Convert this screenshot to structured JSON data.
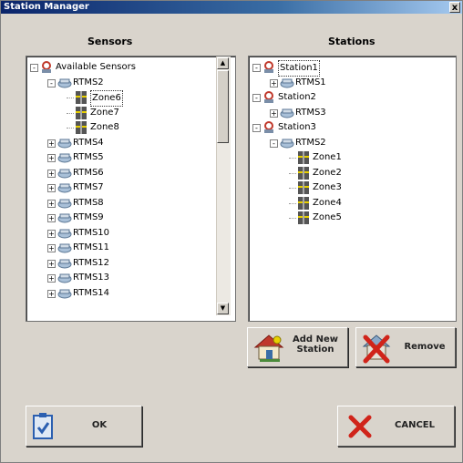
{
  "window": {
    "title": "Station Manager",
    "close_label": "x"
  },
  "sensors": {
    "heading": "Sensors",
    "tree": [
      {
        "label": "Available Sensors",
        "level": 0,
        "expander": "-",
        "icon": "station-icon"
      },
      {
        "label": "RTMS2",
        "level": 1,
        "expander": "-",
        "icon": "sensor-icon"
      },
      {
        "label": "Zone6",
        "level": 2,
        "expander": "",
        "icon": "zone-icon",
        "selected": true
      },
      {
        "label": "Zone7",
        "level": 2,
        "expander": "",
        "icon": "zone-icon"
      },
      {
        "label": "Zone8",
        "level": 2,
        "expander": "",
        "icon": "zone-icon"
      },
      {
        "label": "RTMS4",
        "level": 1,
        "expander": "+",
        "icon": "sensor-icon"
      },
      {
        "label": "RTMS5",
        "level": 1,
        "expander": "+",
        "icon": "sensor-icon"
      },
      {
        "label": "RTMS6",
        "level": 1,
        "expander": "+",
        "icon": "sensor-icon"
      },
      {
        "label": "RTMS7",
        "level": 1,
        "expander": "+",
        "icon": "sensor-icon"
      },
      {
        "label": "RTMS8",
        "level": 1,
        "expander": "+",
        "icon": "sensor-icon"
      },
      {
        "label": "RTMS9",
        "level": 1,
        "expander": "+",
        "icon": "sensor-icon"
      },
      {
        "label": "RTMS10",
        "level": 1,
        "expander": "+",
        "icon": "sensor-icon"
      },
      {
        "label": "RTMS11",
        "level": 1,
        "expander": "+",
        "icon": "sensor-icon"
      },
      {
        "label": "RTMS12",
        "level": 1,
        "expander": "+",
        "icon": "sensor-icon"
      },
      {
        "label": "RTMS13",
        "level": 1,
        "expander": "+",
        "icon": "sensor-icon"
      },
      {
        "label": "RTMS14",
        "level": 1,
        "expander": "+",
        "icon": "sensor-icon"
      }
    ]
  },
  "stations": {
    "heading": "Stations",
    "tree": [
      {
        "label": "Station1",
        "level": 0,
        "expander": "-",
        "icon": "station-icon",
        "selected": true
      },
      {
        "label": "RTMS1",
        "level": 1,
        "expander": "+",
        "icon": "sensor-icon"
      },
      {
        "label": "Station2",
        "level": 0,
        "expander": "-",
        "icon": "station-icon"
      },
      {
        "label": "RTMS3",
        "level": 1,
        "expander": "+",
        "icon": "sensor-icon"
      },
      {
        "label": "Station3",
        "level": 0,
        "expander": "-",
        "icon": "station-icon"
      },
      {
        "label": "RTMS2",
        "level": 1,
        "expander": "-",
        "icon": "sensor-icon"
      },
      {
        "label": "Zone1",
        "level": 2,
        "expander": "",
        "icon": "zone-icon"
      },
      {
        "label": "Zone2",
        "level": 2,
        "expander": "",
        "icon": "zone-icon"
      },
      {
        "label": "Zone3",
        "level": 2,
        "expander": "",
        "icon": "zone-icon"
      },
      {
        "label": "Zone4",
        "level": 2,
        "expander": "",
        "icon": "zone-icon"
      },
      {
        "label": "Zone5",
        "level": 2,
        "expander": "",
        "icon": "zone-icon"
      }
    ]
  },
  "buttons": {
    "add_station_line1": "Add New",
    "add_station_line2": "Station",
    "remove": "Remove",
    "ok": "OK",
    "cancel": "CANCEL"
  },
  "colors": {
    "dialog_bg": "#d9d4cc",
    "titlebar": "#0a246a",
    "station_icon": "#c0392b",
    "sensor_icon": "#8aa8c8",
    "zone_icon": "#555555",
    "zone_stripe": "#e8d000",
    "cancel_x": "#d0241a",
    "ok_icon": "#2b5fb0"
  }
}
